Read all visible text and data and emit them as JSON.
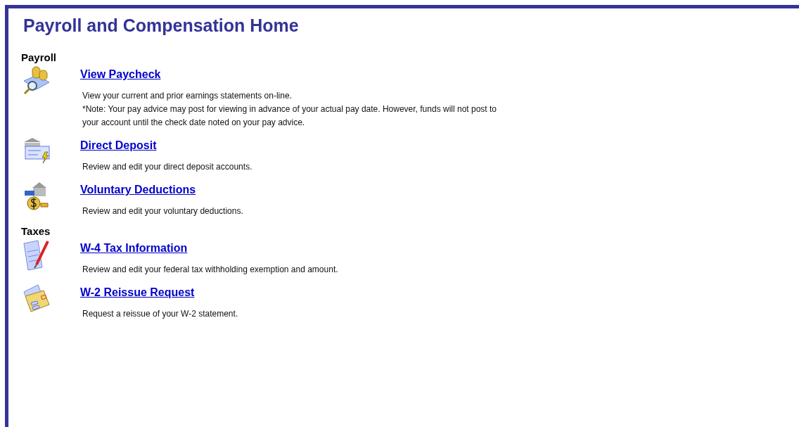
{
  "title": "Payroll and Compensation Home",
  "sections": [
    {
      "heading": "Payroll",
      "items": [
        {
          "kind": "paycheck",
          "link": "View Paycheck",
          "description": "View your current and prior earnings statements on-line.\n*Note: Your pay advice may post for viewing in advance of your actual pay date. However, funds will not post to your account until the check date noted on your pay advice."
        },
        {
          "kind": "deposit",
          "link": "Direct Deposit",
          "description": "Review and edit your direct deposit accounts."
        },
        {
          "kind": "deductions",
          "link": "Voluntary Deductions",
          "description": "Review and edit your voluntary deductions."
        }
      ]
    },
    {
      "heading": "Taxes",
      "items": [
        {
          "kind": "w4",
          "link": "W-4 Tax Information",
          "description": "Review and edit your federal tax withholding exemption and amount."
        },
        {
          "kind": "w2",
          "link": "W-2 Reissue Request",
          "description": "Request a reissue of your W-2 statement."
        }
      ]
    }
  ]
}
